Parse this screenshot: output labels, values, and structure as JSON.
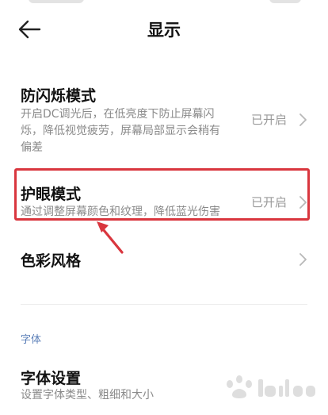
{
  "header": {
    "title": "显示",
    "back_icon": "arrow-left-icon"
  },
  "rows": {
    "dc_dimming": {
      "title": "防闪烁模式",
      "desc_line1": "开启DC调光后，在低亮度下防止屏幕闪",
      "desc_line2": "烁，降低视觉疲劳，屏幕局部显示会稍有",
      "desc_line3": "偏差",
      "status": "已开启"
    },
    "eye_care": {
      "title": "护眼模式",
      "desc": "通过调整屏幕颜色和纹理，降低蓝光伤害",
      "status": "已开启"
    },
    "color_style": {
      "title": "色彩风格"
    },
    "font_settings": {
      "title": "字体设置",
      "desc": "设置字体类型、粗细和大小"
    }
  },
  "section": {
    "font_label": "字体"
  },
  "annotation": {
    "highlight_color": "#d9363e"
  },
  "icons": {
    "chevron": "chevron-right-icon",
    "watermark": "baidu-jingyan-watermark"
  }
}
